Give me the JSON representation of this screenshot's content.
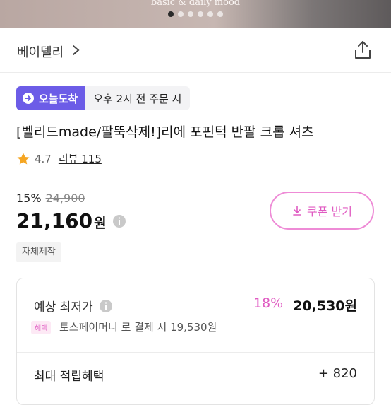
{
  "hero": {
    "caption": "basic & daily mood",
    "dots": 6,
    "active_dot": 0
  },
  "brand": {
    "name": "베이델리"
  },
  "badge": {
    "primary": "오늘도착",
    "secondary": "오후 2시 전 주문 시"
  },
  "product": {
    "title": "[벨리드made/팔뚝삭제!]리에 포핀턱 반팔 크롭 셔츠"
  },
  "rating": {
    "score": "4.7",
    "reviews": "리뷰 115"
  },
  "price": {
    "discount_rate": "15%",
    "original": "24,900",
    "current": "21,160",
    "unit": "원"
  },
  "coupon": {
    "label": "쿠폰 받기"
  },
  "tag": {
    "label": "자체제작"
  },
  "expected": {
    "label": "예상 최저가",
    "rate": "18%",
    "price": "20,530원",
    "benefit_tag": "혜택",
    "benefit_text": "토스페이머니 로 결제 시 19,530원"
  },
  "points": {
    "label": "최대 적립혜택",
    "value": "+ 820"
  },
  "colors": {
    "accent_purple": "#6c5ce7",
    "accent_pink": "#e05bc2",
    "coupon_border": "#ee8bd6"
  },
  "icons": [
    "chevron-right-icon",
    "share-icon",
    "truck-icon",
    "star-icon",
    "info-icon",
    "download-icon"
  ]
}
